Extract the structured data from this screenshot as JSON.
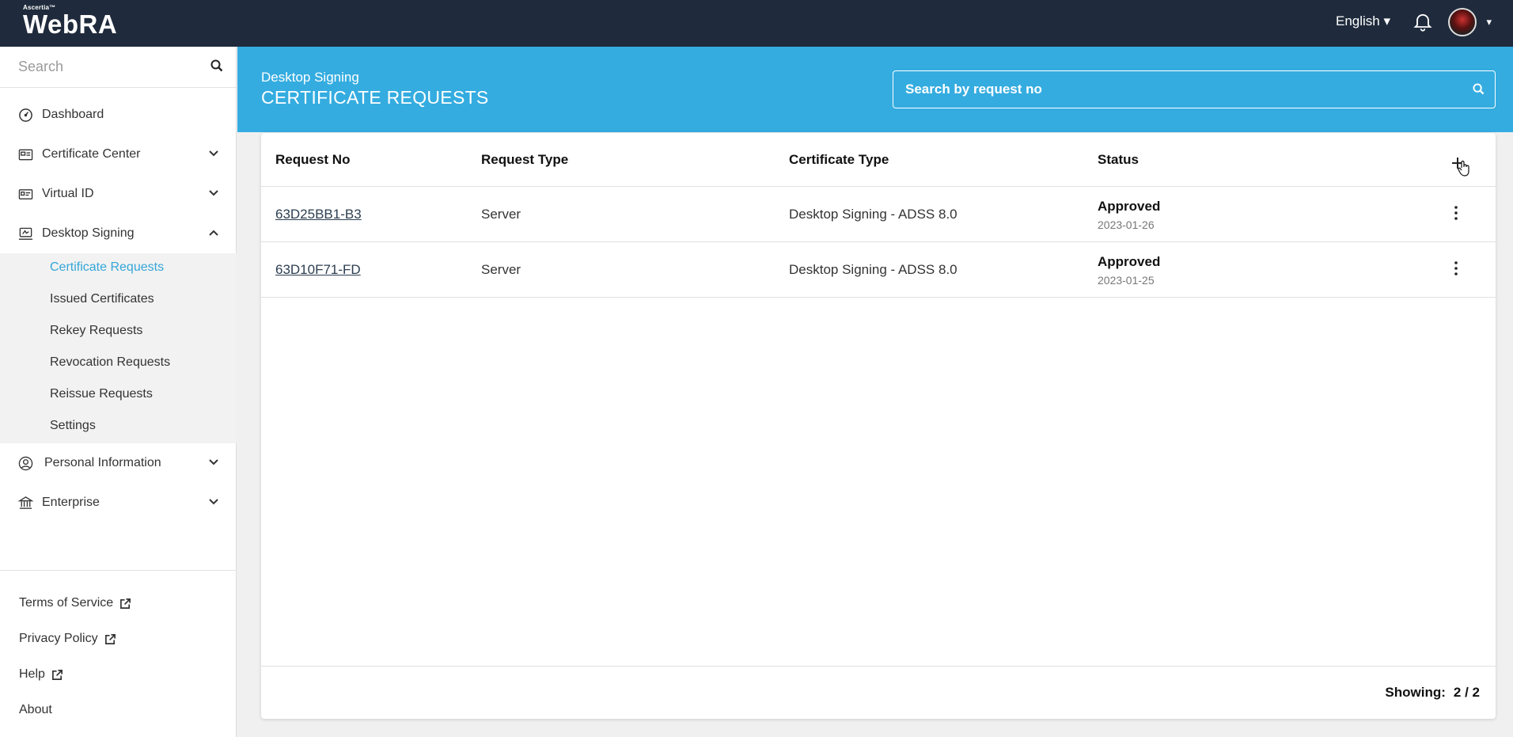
{
  "app": {
    "brand_small": "Ascertia™",
    "brand_name": "WebRA",
    "language": "English ▾",
    "avatar_caret": "▾"
  },
  "sidebar": {
    "search_placeholder": "Search",
    "items": [
      {
        "label": "Dashboard",
        "icon": "dashboard-icon",
        "expandable": false
      },
      {
        "label": "Certificate Center",
        "icon": "certificate-icon",
        "expandable": true
      },
      {
        "label": "Virtual ID",
        "icon": "id-card-icon",
        "expandable": true
      },
      {
        "label": "Desktop Signing",
        "icon": "desktop-signing-icon",
        "expandable": true,
        "expanded": true
      },
      {
        "label": "Personal Information",
        "icon": "user-circle-icon",
        "expandable": true
      },
      {
        "label": "Enterprise",
        "icon": "bank-icon",
        "expandable": true
      }
    ],
    "subitems": [
      {
        "label": "Certificate Requests",
        "active": true
      },
      {
        "label": "Issued Certificates"
      },
      {
        "label": "Rekey Requests"
      },
      {
        "label": "Revocation Requests"
      },
      {
        "label": "Reissue Requests"
      },
      {
        "label": "Settings"
      }
    ],
    "footer_links": [
      {
        "label": "Terms of Service",
        "external": true
      },
      {
        "label": "Privacy Policy",
        "external": true
      },
      {
        "label": "Help",
        "external": true
      },
      {
        "label": "About",
        "external": false
      }
    ]
  },
  "header": {
    "subtitle": "Desktop Signing",
    "title": "CERTIFICATE REQUESTS",
    "search_placeholder": "Search by request no"
  },
  "table": {
    "columns": [
      "Request No",
      "Request Type",
      "Certificate Type",
      "Status"
    ],
    "rows": [
      {
        "request_no": "63D25BB1-B3",
        "request_type": "Server",
        "certificate_type": "Desktop Signing - ADSS 8.0",
        "status": "Approved",
        "date": "2023-01-26"
      },
      {
        "request_no": "63D10F71-FD",
        "request_type": "Server",
        "certificate_type": "Desktop Signing - ADSS 8.0",
        "status": "Approved",
        "date": "2023-01-25"
      }
    ],
    "showing_label": "Showing:",
    "showing_value": "2 / 2"
  },
  "colors": {
    "topbar": "#1f2b3c",
    "accent": "#34ace0",
    "active_link": "#34a6d9"
  }
}
